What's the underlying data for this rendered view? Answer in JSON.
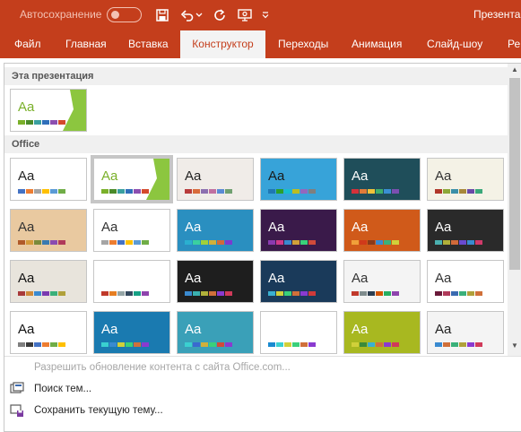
{
  "titlebar": {
    "autosave_label": "Автосохранение",
    "document_title": "Презентац"
  },
  "quick_access": [
    "save-icon",
    "undo-icon",
    "undo-dropdown-icon",
    "redo-icon",
    "present-from-start-icon",
    "customize-toolbar-icon"
  ],
  "ribbon": {
    "tabs": [
      {
        "label": "Файл",
        "active": false
      },
      {
        "label": "Главная",
        "active": false
      },
      {
        "label": "Вставка",
        "active": false
      },
      {
        "label": "Конструктор",
        "active": true
      },
      {
        "label": "Переходы",
        "active": false
      },
      {
        "label": "Анимация",
        "active": false
      },
      {
        "label": "Слайд-шоу",
        "active": false
      },
      {
        "label": "Ре",
        "active": false
      }
    ]
  },
  "theme_gallery": {
    "section_this_presentation": "Эта презентация",
    "section_office": "Office",
    "sample_text": "Aa",
    "current_theme": {
      "bg": "#ffffff",
      "fg": "#7ab02a",
      "accent": "#8cc63f",
      "swatches": [
        "#7ab02a",
        "#4a8a2a",
        "#3aa0a0",
        "#2f6fba",
        "#8c4fb0",
        "#d44a2c"
      ]
    },
    "themes": [
      {
        "bg": "#ffffff",
        "fg": "#222222",
        "swatches": [
          "#4472c4",
          "#ed7d31",
          "#a5a5a5",
          "#ffc000",
          "#5b9bd5",
          "#70ad47"
        ]
      },
      {
        "bg": "#ffffff",
        "fg": "#7ab02a",
        "swatches": [
          "#7ab02a",
          "#4a8a2a",
          "#3aa0a0",
          "#2f6fba",
          "#8c4fb0",
          "#d44a2c"
        ],
        "selected": true
      },
      {
        "bg": "#f0ece8",
        "fg": "#222222",
        "swatches": [
          "#b83b3b",
          "#d86b3b",
          "#8c6fb0",
          "#c070a0",
          "#5b8bd5",
          "#70a070"
        ]
      },
      {
        "bg": "#37a3d9",
        "fg": "#1a1a1a",
        "swatches": [
          "#1f77b4",
          "#2ca02c",
          "#17becf",
          "#bcbd22",
          "#9467bd",
          "#7f7f7f"
        ]
      },
      {
        "bg": "#1f4e5a",
        "fg": "#ffffff",
        "swatches": [
          "#d4313a",
          "#e07b39",
          "#f0c23a",
          "#3fae6a",
          "#3a8fd4",
          "#7b4fb0"
        ]
      },
      {
        "bg": "#f4f2e6",
        "fg": "#333333",
        "swatches": [
          "#b0372a",
          "#8ca838",
          "#3a8fa8",
          "#a8883a",
          "#6a4aa8",
          "#3aa87a"
        ]
      },
      {
        "bg": "#e9c9a0",
        "fg": "#333333",
        "swatches": [
          "#b05a2a",
          "#d49a3a",
          "#7a8a3a",
          "#3a7ab0",
          "#8a4ab0",
          "#b03a5a"
        ]
      },
      {
        "bg": "#ffffff",
        "fg": "#333333",
        "swatches": [
          "#a5a5a5",
          "#ed7d31",
          "#4472c4",
          "#ffc000",
          "#5b9bd5",
          "#70ad47"
        ]
      },
      {
        "bg": "#2a8fc0",
        "fg": "#ffffff",
        "swatches": [
          "#2ab0d0",
          "#3ad0a0",
          "#a0d03a",
          "#d0b03a",
          "#d06a3a",
          "#7a3ad0"
        ]
      },
      {
        "bg": "#3a1a4a",
        "fg": "#ffffff",
        "swatches": [
          "#8a3ab0",
          "#d03a8a",
          "#3a8ad0",
          "#d0a03a",
          "#3ad07a",
          "#d04a3a"
        ]
      },
      {
        "bg": "#d05a1a",
        "fg": "#ffffff",
        "swatches": [
          "#f0a03a",
          "#d03a1a",
          "#8a3a1a",
          "#3a8ad0",
          "#3ab07a",
          "#d0d03a"
        ]
      },
      {
        "bg": "#2a2a2a",
        "fg": "#ffffff",
        "swatches": [
          "#4ab0b0",
          "#b0b03a",
          "#d06a3a",
          "#6a4ad0",
          "#3a8ad0",
          "#d03a6a"
        ]
      },
      {
        "bg": "#e8e4dc",
        "fg": "#111111",
        "swatches": [
          "#a83a3a",
          "#d08a3a",
          "#3a8ad0",
          "#7a3ab0",
          "#3ab07a",
          "#b0a03a"
        ]
      },
      {
        "bg": "#ffffff",
        "fg": "#ffffff",
        "swatches": [
          "#c0392b",
          "#e67e22",
          "#95a5a6",
          "#34495e",
          "#16a085",
          "#8e44ad"
        ]
      },
      {
        "bg": "#1e1e1e",
        "fg": "#ffffff",
        "swatches": [
          "#3a8ad0",
          "#3ab0b0",
          "#b0b03a",
          "#d0703a",
          "#8a3ad0",
          "#d03a5a"
        ]
      },
      {
        "bg": "#1a3a5a",
        "fg": "#ffffff",
        "swatches": [
          "#3ab0d0",
          "#d0d03a",
          "#3ad07a",
          "#d0703a",
          "#8a3ad0",
          "#d03a3a"
        ]
      },
      {
        "bg": "#f4f4f4",
        "fg": "#333333",
        "swatches": [
          "#c0392b",
          "#7f8c8d",
          "#2c3e50",
          "#d35400",
          "#27ae60",
          "#8e44ad"
        ]
      },
      {
        "bg": "#ffffff",
        "fg": "#333333",
        "swatches": [
          "#6a1a3a",
          "#b03a5a",
          "#3a6ab0",
          "#3ab07a",
          "#b0a03a",
          "#d0703a"
        ]
      },
      {
        "bg": "#ffffff",
        "fg": "#111111",
        "swatches": [
          "#7f7f7f",
          "#3a3a3a",
          "#4472c4",
          "#ed7d31",
          "#70ad47",
          "#ffc000"
        ]
      },
      {
        "bg": "#1a7ab0",
        "fg": "#ffffff",
        "swatches": [
          "#3ad0d0",
          "#3a8ad0",
          "#d0d03a",
          "#3ad07a",
          "#d0703a",
          "#8a3ad0"
        ]
      },
      {
        "bg": "#3aa0b8",
        "fg": "#ffffff",
        "swatches": [
          "#3ad0d0",
          "#3a6ad0",
          "#d0b03a",
          "#3ad07a",
          "#d04a3a",
          "#8a3ad0"
        ]
      },
      {
        "bg": "#ffffff",
        "fg": "#ffffff",
        "swatches": [
          "#1a8ad0",
          "#3ad0d0",
          "#d0d03a",
          "#3ad07a",
          "#d0703a",
          "#8a3ad0"
        ]
      },
      {
        "bg": "#a8b820",
        "fg": "#ffffff",
        "swatches": [
          "#d0d03a",
          "#3a8a3a",
          "#3ab0d0",
          "#d0703a",
          "#8a3ad0",
          "#d03a5a"
        ]
      },
      {
        "bg": "#f4f4f4",
        "fg": "#222222",
        "swatches": [
          "#3a8ad0",
          "#d0703a",
          "#3ab07a",
          "#b0a03a",
          "#8a3ad0",
          "#d03a5a"
        ]
      }
    ]
  },
  "menu": {
    "enable_updates": "Разрешить обновление контента с сайта Office.com...",
    "browse_themes": "Поиск тем...",
    "save_theme": "Сохранить текущую тему..."
  }
}
